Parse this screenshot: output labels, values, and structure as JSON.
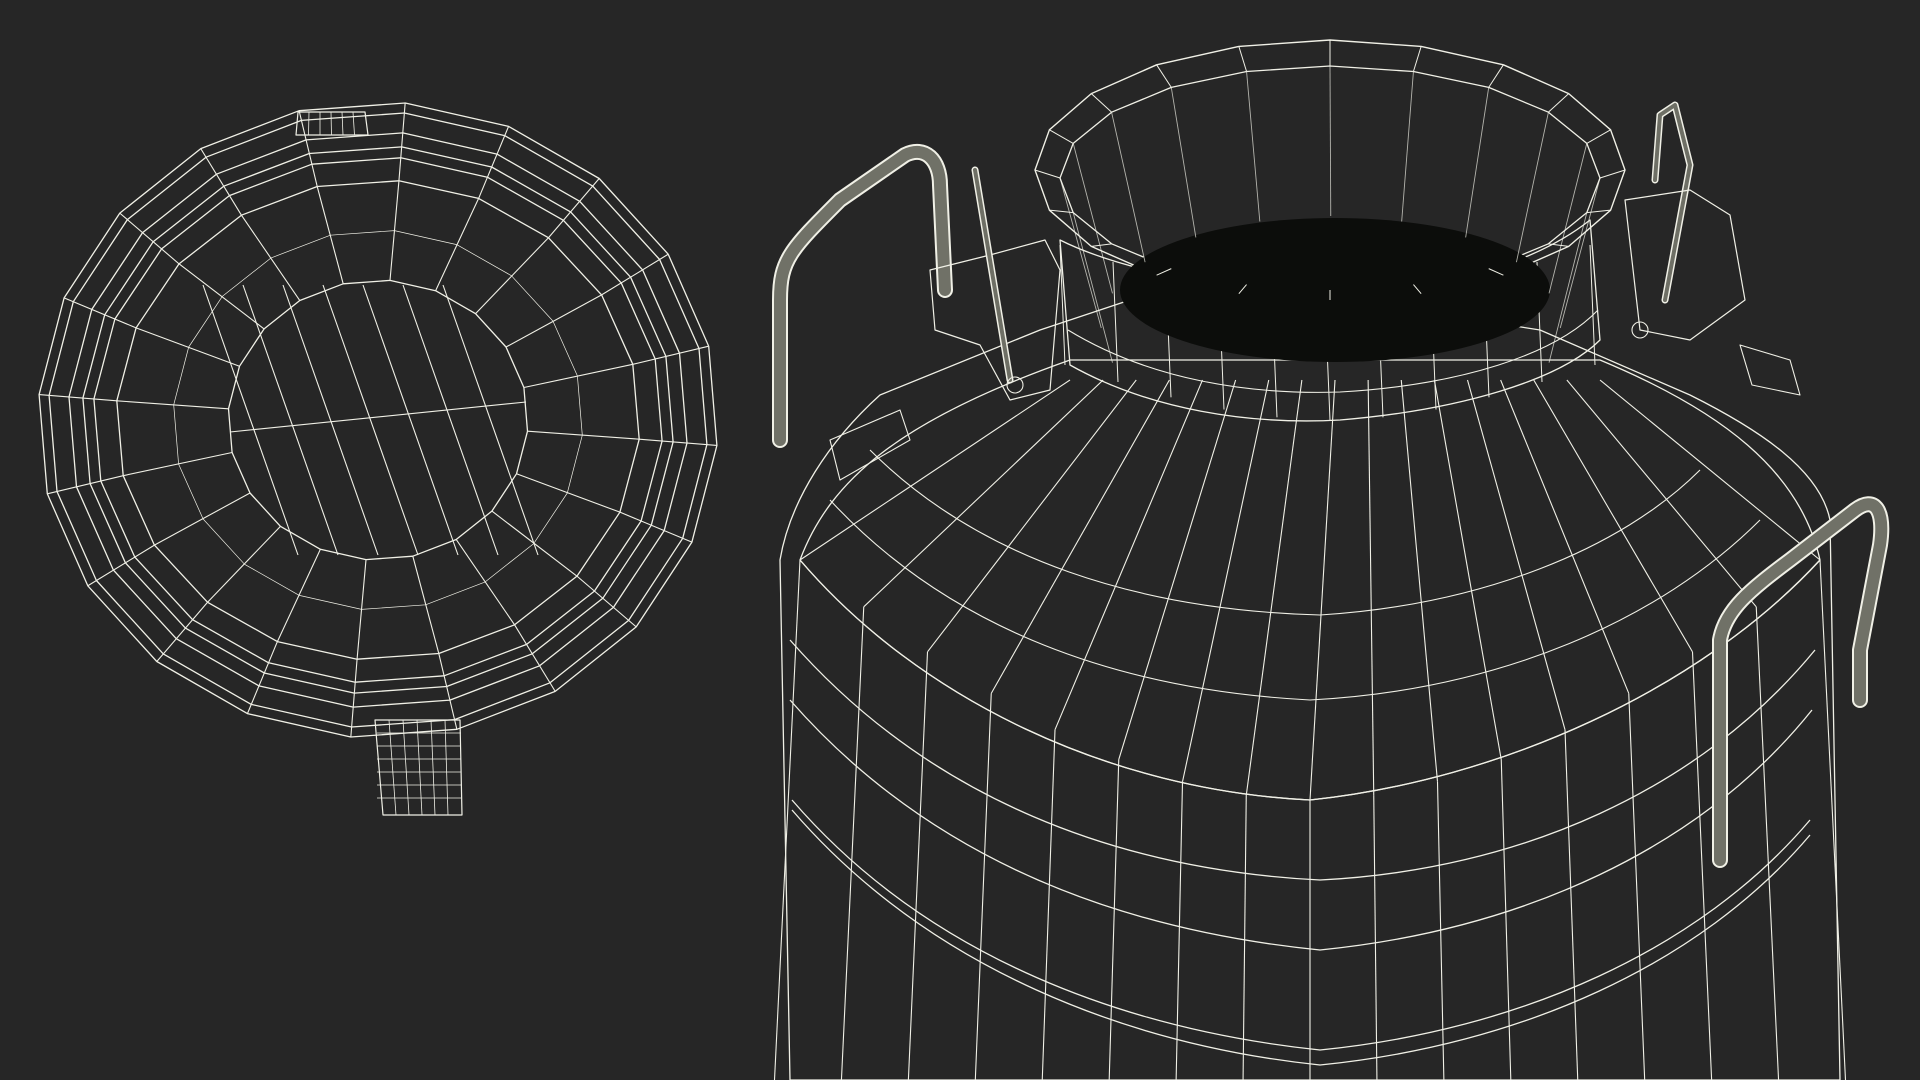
{
  "scene": {
    "background_color": "#262626",
    "surface_color": "#7a7b70",
    "surface_dark_color": "#5f6056",
    "wire_color": "#f0f0e6",
    "interior_color": "#0c0d0b",
    "objects": [
      "milk-can-lid",
      "milk-can-body"
    ]
  }
}
